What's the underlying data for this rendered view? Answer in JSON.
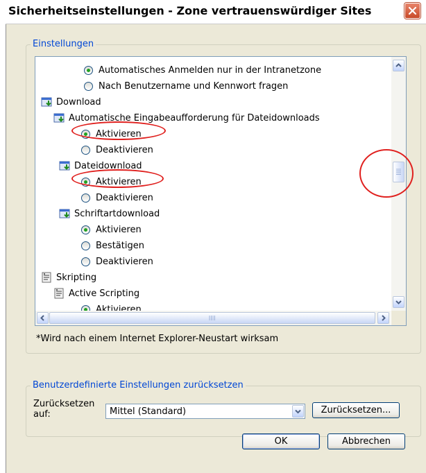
{
  "window": {
    "title": "Sicherheitseinstellungen - Zone vertrauenswürdiger Sites"
  },
  "settings": {
    "legend": "Einstellungen",
    "rows": [
      {
        "type": "radio",
        "checked": true,
        "label": "Automatisches Anmelden nur in der Intranetzone"
      },
      {
        "type": "radio",
        "checked": false,
        "label": "Nach Benutzername und Kennwort fragen"
      },
      {
        "type": "category",
        "icon": "download-icon",
        "label": "Download"
      },
      {
        "type": "category",
        "icon": "download-icon",
        "label": "Automatische Eingabeaufforderung für Dateidownloads"
      },
      {
        "type": "radio",
        "checked": true,
        "label": "Aktivieren"
      },
      {
        "type": "radio",
        "checked": false,
        "label": "Deaktivieren"
      },
      {
        "type": "category",
        "icon": "download-icon",
        "label": "Dateidownload"
      },
      {
        "type": "radio",
        "checked": true,
        "label": "Aktivieren"
      },
      {
        "type": "radio",
        "checked": false,
        "label": "Deaktivieren"
      },
      {
        "type": "category",
        "icon": "download-icon",
        "label": "Schriftartdownload"
      },
      {
        "type": "radio",
        "checked": true,
        "label": "Aktivieren"
      },
      {
        "type": "radio",
        "checked": false,
        "label": "Bestätigen"
      },
      {
        "type": "radio",
        "checked": false,
        "label": "Deaktivieren"
      },
      {
        "type": "category",
        "icon": "script-icon",
        "label": "Skripting"
      },
      {
        "type": "category",
        "icon": "script-icon",
        "label": "Active Scripting"
      },
      {
        "type": "radio",
        "checked": true,
        "label": "Aktivieren"
      }
    ],
    "note": "*Wird nach einem Internet Explorer-Neustart wirksam"
  },
  "reset": {
    "legend": "Benutzerdefinierte Einstellungen zurücksetzen",
    "label": "Zurücksetzen auf:",
    "select_value": "Mittel (Standard)",
    "button_label": "Zurücksetzen..."
  },
  "footer": {
    "ok_label": "OK",
    "cancel_label": "Abbrechen"
  },
  "colors": {
    "legend": "#0046d5",
    "annotation": "#e0201e",
    "close_button": "#c84a28"
  }
}
